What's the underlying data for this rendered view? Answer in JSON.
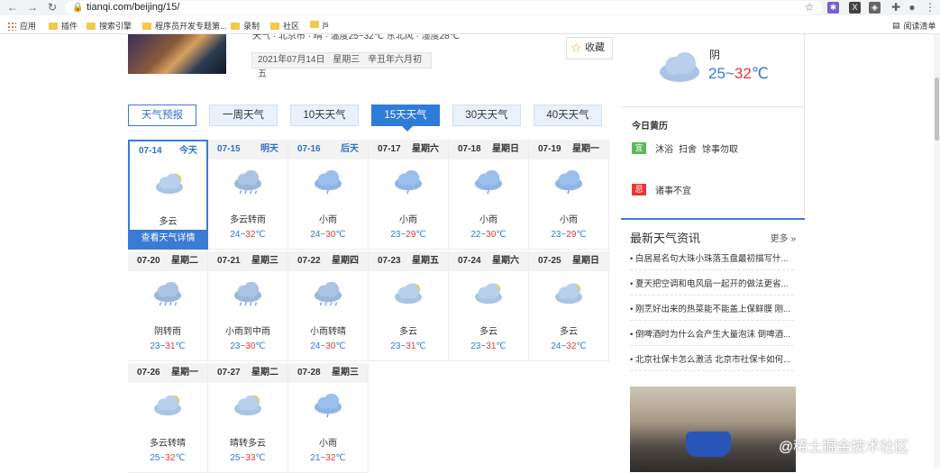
{
  "browser": {
    "url": "tianqi.com/beijing/15/",
    "reading_list": "阅读清单",
    "bookmarks": [
      "应用",
      "插件",
      "搜索引擎",
      "程序员开发专题第...",
      "录制",
      "社区",
      "js"
    ]
  },
  "header": {
    "top_text": "天气 · 北京市 · 晴 · 温度25~32℃ 东北风 · 湿度28℃",
    "date": "2021年07月14日",
    "weekday": "星期三",
    "lunar": "辛丑年六月初五",
    "collect_label": "收藏"
  },
  "current": {
    "desc": "阴",
    "low": "25",
    "sep": "~",
    "high": "32",
    "unit": "℃"
  },
  "tabs": [
    "天气预报",
    "一周天气",
    "10天天气",
    "15天天气",
    "30天天气",
    "40天天气"
  ],
  "days": [
    {
      "date": "07-14",
      "week": "今天",
      "desc": "多云",
      "low": "",
      "high": "",
      "icon": "partly-cloudy-icon",
      "today": true,
      "detail": "查看天气详情"
    },
    {
      "date": "07-15",
      "week": "明天",
      "desc": "多云转雨",
      "low": "24",
      "high": "32",
      "icon": "rain-cloud-icon",
      "blue": true
    },
    {
      "date": "07-16",
      "week": "后天",
      "desc": "小雨",
      "low": "24",
      "high": "30",
      "icon": "light-rain-icon",
      "blue": true
    },
    {
      "date": "07-17",
      "week": "星期六",
      "desc": "小雨",
      "low": "23",
      "high": "29",
      "icon": "light-rain-icon"
    },
    {
      "date": "07-18",
      "week": "星期日",
      "desc": "小雨",
      "low": "22",
      "high": "30",
      "icon": "light-rain-icon"
    },
    {
      "date": "07-19",
      "week": "星期一",
      "desc": "小雨",
      "low": "23",
      "high": "29",
      "icon": "light-rain-icon"
    },
    {
      "date": "07-20",
      "week": "星期二",
      "desc": "阴转雨",
      "low": "23",
      "high": "31",
      "icon": "rain-cloud-icon"
    },
    {
      "date": "07-21",
      "week": "星期三",
      "desc": "小雨到中雨",
      "low": "23",
      "high": "30",
      "icon": "rain-cloud-icon"
    },
    {
      "date": "07-22",
      "week": "星期四",
      "desc": "小雨转晴",
      "low": "24",
      "high": "30",
      "icon": "rain-cloud-icon"
    },
    {
      "date": "07-23",
      "week": "星期五",
      "desc": "多云",
      "low": "23",
      "high": "31",
      "icon": "partly-cloudy-icon"
    },
    {
      "date": "07-24",
      "week": "星期六",
      "desc": "多云",
      "low": "23",
      "high": "31",
      "icon": "partly-cloudy-icon"
    },
    {
      "date": "07-25",
      "week": "星期日",
      "desc": "多云",
      "low": "24",
      "high": "32",
      "icon": "partly-cloudy-icon"
    },
    {
      "date": "07-26",
      "week": "星期一",
      "desc": "多云转晴",
      "low": "25",
      "high": "32",
      "icon": "partly-cloudy-icon"
    },
    {
      "date": "07-27",
      "week": "星期二",
      "desc": "晴转多云",
      "low": "25",
      "high": "33",
      "icon": "partly-cloudy-icon"
    },
    {
      "date": "07-28",
      "week": "星期三",
      "desc": "小雨",
      "low": "21",
      "high": "32",
      "icon": "light-rain-icon"
    }
  ],
  "temp_sep": "~",
  "temp_unit": "℃",
  "huangli": {
    "title": "今日黄历",
    "yi_label": "宜",
    "yi": [
      "沐浴",
      "扫舍",
      "馀事勿取"
    ],
    "ji_label": "忌",
    "ji": [
      "诸事不宜"
    ]
  },
  "news": {
    "title": "最新天气资讯",
    "more": "更多",
    "items": [
      "白居易名句大珠小珠落玉盘最初描写什...",
      "夏天把空调和电风扇一起开的做法更省...",
      "刚烹好出来的热菜能不能盖上保鲜膜 刚...",
      "倒啤酒时为什么会产生大量泡沫 倒啤酒...",
      "北京社保卡怎么激活 北京市社保卡如何..."
    ]
  },
  "watermark": "@稀土掘金技术社区",
  "colors": {
    "accent": "#2f7cd8",
    "high_temp": "#e53935"
  }
}
